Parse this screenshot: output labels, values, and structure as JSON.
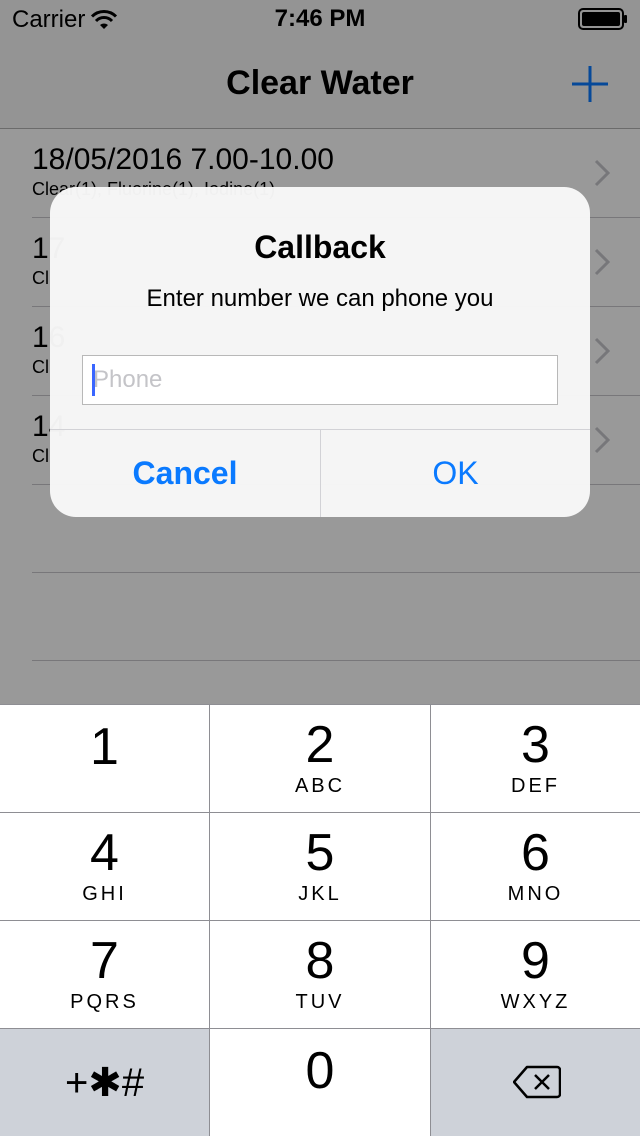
{
  "status_bar": {
    "carrier": "Carrier",
    "time": "7:46 PM"
  },
  "nav": {
    "title": "Clear Water",
    "add_icon": "plus-icon"
  },
  "list": {
    "rows": [
      {
        "title": "18/05/2016 7.00-10.00",
        "subtitle": "Clear(1), Fluorine(1), Iodine(1)"
      },
      {
        "title": "17",
        "subtitle": "Cl"
      },
      {
        "title": "16",
        "subtitle": "Cl"
      },
      {
        "title": "14",
        "subtitle": "Cl"
      }
    ]
  },
  "alert": {
    "title": "Callback",
    "message": "Enter number we can phone you",
    "placeholder": "Phone",
    "value": "",
    "cancel": "Cancel",
    "ok": "OK"
  },
  "keypad": {
    "keys": [
      {
        "digit": "1",
        "letters": ""
      },
      {
        "digit": "2",
        "letters": "ABC"
      },
      {
        "digit": "3",
        "letters": "DEF"
      },
      {
        "digit": "4",
        "letters": "GHI"
      },
      {
        "digit": "5",
        "letters": "JKL"
      },
      {
        "digit": "6",
        "letters": "MNO"
      },
      {
        "digit": "7",
        "letters": "PQRS"
      },
      {
        "digit": "8",
        "letters": "TUV"
      },
      {
        "digit": "9",
        "letters": "WXYZ"
      },
      {
        "digit": "+✱#",
        "letters": ""
      },
      {
        "digit": "0",
        "letters": ""
      },
      {
        "digit": "",
        "letters": ""
      }
    ]
  },
  "colors": {
    "accent": "#0a7aff",
    "caret": "#3a66ff"
  }
}
